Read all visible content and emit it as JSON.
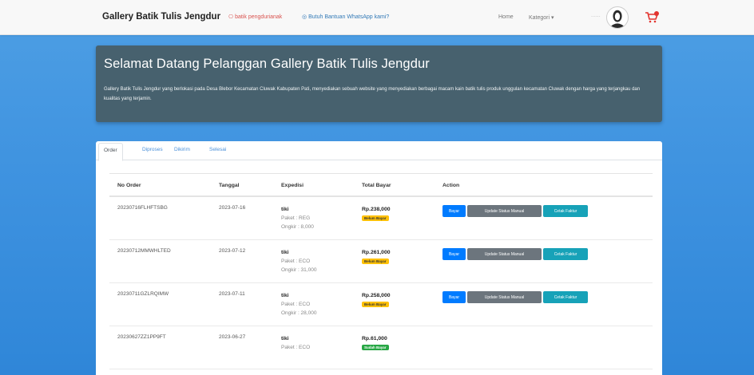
{
  "navbar": {
    "brand": "Gallery Batik Tulis Jengdur",
    "link_red": "batik pengdurianak",
    "link_blue": "Butuh Bantuan WhatsApp kami?",
    "home": "Home",
    "kategori": "Kategori ▾",
    "user_label": "......"
  },
  "jumbotron": {
    "title": "Selamat Datang Pelanggan Gallery Batik Tulis Jengdur",
    "text": "Gallery Batik Tulis Jengdur yang berlokasi pada Desa Blebor Kecamatan Cluwak Kabupaten Pati, menyediakan sebuah website yang menyediakan berbagai macam kain batik tulis produk unggulan kecamatan Cluwak dengan harga yang terjangkau dan kualitas yang terjamin."
  },
  "tabs": [
    {
      "label": "Order"
    },
    {
      "label": "Diproses"
    },
    {
      "label": "Dikirim"
    },
    {
      "label": "Selesai"
    }
  ],
  "table": {
    "headers": {
      "order": "No Order",
      "date": "Tanggal",
      "expedition": "Expedisi",
      "total": "Total Bayar",
      "action": "Action"
    },
    "buttons": {
      "pay": "Bayar",
      "update": "Update Status Manual",
      "invoice": "Cetak Faktur"
    },
    "rows": [
      {
        "order_no": "20230716FLHFTSBG",
        "date": "2023-07-16",
        "courier": "tiki",
        "package": "Paket : REG",
        "shipping": "Ongkir : 8,000",
        "total": "Rp.238,000",
        "status": "Belum Bayar",
        "status_type": "warn"
      },
      {
        "order_no": "20230712MMWHLTED",
        "date": "2023-07-12",
        "courier": "tiki",
        "package": "Paket : ECO",
        "shipping": "Ongkir : 31,000",
        "total": "Rp.261,000",
        "status": "Belum Bayar",
        "status_type": "warn"
      },
      {
        "order_no": "20230711GZLRQIMW",
        "date": "2023-07-11",
        "courier": "tiki",
        "package": "Paket : ECO",
        "shipping": "Ongkir : 28,000",
        "total": "Rp.258,000",
        "status": "Belum Bayar",
        "status_type": "warn"
      },
      {
        "order_no": "20230627ZZ1PP9FT",
        "date": "2023-06-27",
        "courier": "tiki",
        "package": "Paket : ECO",
        "shipping": "",
        "total": "Rp.61,000",
        "status": "Sudah Bayar",
        "status_type": "ok"
      }
    ]
  },
  "colors": {
    "background": "#3f93e0",
    "jumbotron": "#47616e",
    "primary": "#007bff",
    "secondary": "#6c757d",
    "info": "#17a2b8",
    "warning": "#ffc107",
    "success": "#28a745"
  }
}
